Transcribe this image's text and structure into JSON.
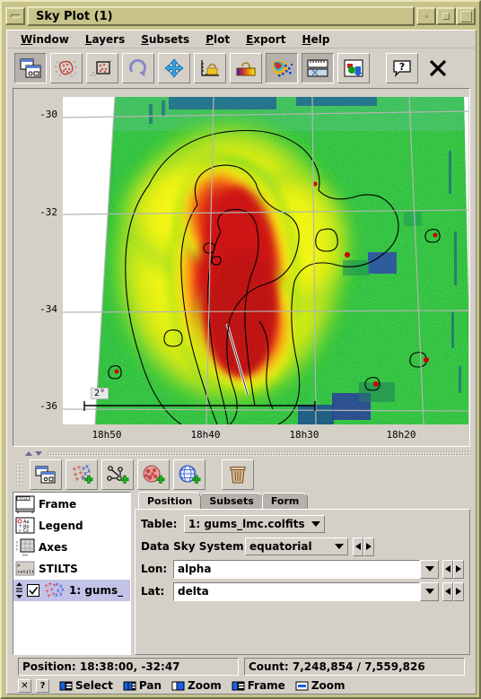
{
  "window": {
    "title": "Sky Plot (1)",
    "buttons": {
      "minimize": "minimize",
      "restore": "restore",
      "maximize": "maximize"
    }
  },
  "menubar": {
    "items": [
      {
        "label": "Window",
        "mnemonic": "W"
      },
      {
        "label": "Layers",
        "mnemonic": "L"
      },
      {
        "label": "Subsets",
        "mnemonic": "S"
      },
      {
        "label": "Plot",
        "mnemonic": "P"
      },
      {
        "label": "Export",
        "mnemonic": "E"
      },
      {
        "label": "Help",
        "mnemonic": "H"
      }
    ]
  },
  "toolbar": {
    "items": [
      {
        "name": "split-window-icon",
        "tip": "Split Window",
        "selected": true
      },
      {
        "name": "blob-select-icon",
        "tip": "Draw Blob Subset",
        "selected": false
      },
      {
        "name": "rectangle-select-icon",
        "tip": "Draw Subset Region",
        "selected": false
      },
      {
        "name": "rescale-icon",
        "tip": "Rescale",
        "selected": false
      },
      {
        "name": "axis-pan-icon",
        "tip": "Axis Lock / Navigate",
        "selected": false
      },
      {
        "name": "axis-lock-icon",
        "tip": "Lock Axes",
        "selected": false
      },
      {
        "name": "aux-lock-icon",
        "tip": "Lock Aux Range",
        "selected": false
      },
      {
        "name": "sketch-icon",
        "tip": "Sketch Frames",
        "selected": true
      },
      {
        "name": "progress-bar-icon",
        "tip": "Show Progress Bar",
        "selected": true
      },
      {
        "name": "export-image-icon",
        "tip": "Export Plot",
        "selected": false
      },
      {
        "name": "help-icon",
        "tip": "Help",
        "selected": false
      },
      {
        "name": "close-icon",
        "tip": "Close",
        "selected": false
      }
    ]
  },
  "plot": {
    "y_ticks": [
      "-30",
      "-32",
      "-34",
      "-36"
    ],
    "x_ticks": [
      "18h50",
      "18h40",
      "18h30",
      "18h20"
    ],
    "scalebar_label": "2°",
    "background": "#ffffff",
    "grid_color": "#b4b4b4",
    "contour_color": "#000000"
  },
  "chart_data": {
    "type": "heatmap",
    "title": "",
    "xlabel": "",
    "ylabel": "",
    "xtick_labels": [
      "18h50",
      "18h40",
      "18h30",
      "18h20"
    ],
    "ytick_labels": [
      "-30",
      "-32",
      "-34",
      "-36"
    ],
    "scale_annotation": "2°",
    "colormap": [
      "#0000b4",
      "#00a0ff",
      "#00c800",
      "#32e032",
      "#ffff00",
      "#ff8000",
      "#e00000",
      "#b40000"
    ],
    "grid": true,
    "legend": false,
    "description": "Sky density map of the LMC field in equatorial coordinates with black density contours and low-coverage blue rectangular gaps."
  },
  "layer_toolbar": {
    "items": [
      {
        "name": "split-window-icon",
        "tip": "Split Window"
      },
      {
        "name": "add-position-layer-icon",
        "tip": "Add Position Control"
      },
      {
        "name": "add-pair-layer-icon",
        "tip": "Add Pair Position Control"
      },
      {
        "name": "add-histogram-layer-icon",
        "tip": "Add Histogram Control"
      },
      {
        "name": "add-sky-layer-icon",
        "tip": "Add Sky Grid Control"
      },
      {
        "name": "remove-layer-icon",
        "tip": "Remove Control"
      }
    ]
  },
  "tree": {
    "items": [
      {
        "label": "Frame",
        "icon": "title-frame-icon",
        "selected": false,
        "checkbox": false
      },
      {
        "label": "Legend",
        "icon": "legend-icon",
        "selected": false,
        "checkbox": false
      },
      {
        "label": "Axes",
        "icon": "axes-icon",
        "selected": false,
        "checkbox": false
      },
      {
        "label": "STILTS",
        "icon": "stilts-icon",
        "selected": false,
        "checkbox": false
      },
      {
        "label": "1: gums_",
        "icon": "scatter-layer-icon",
        "selected": true,
        "checkbox": true,
        "checked": true
      }
    ]
  },
  "tabs": [
    {
      "label": "Position",
      "active": true
    },
    {
      "label": "Subsets",
      "active": false
    },
    {
      "label": "Form",
      "active": false
    }
  ],
  "form": {
    "table_label": "Table:",
    "table_value": "1: gums_lmc.colfits",
    "sky_system_label": "Data Sky System:",
    "sky_system_value": "equatorial",
    "lon_label": "Lon:",
    "lon_value": "alpha",
    "lat_label": "Lat:",
    "lat_value": "delta"
  },
  "status": {
    "position": "Position: 18:38:00, -32:47",
    "count": "Count: 7,248,854 / 7,559,826"
  },
  "mouse_actions": {
    "close_label": "✕",
    "help_label": "?",
    "items": [
      {
        "label": "Select",
        "button": "left"
      },
      {
        "label": "Pan",
        "button": "middle"
      },
      {
        "label": "Zoom",
        "button": "right"
      },
      {
        "label": "Frame",
        "button": "left-drag"
      },
      {
        "label": "Zoom",
        "button": "wheel"
      }
    ]
  }
}
